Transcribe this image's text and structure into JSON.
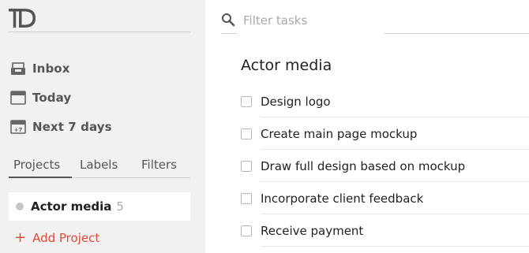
{
  "app": {
    "logo_text": "TD"
  },
  "sidebar": {
    "nav": [
      {
        "label": "Inbox",
        "icon": "inbox-icon"
      },
      {
        "label": "Today",
        "icon": "calendar-today-icon"
      },
      {
        "label": "Next 7 days",
        "icon": "calendar-week-icon",
        "icon_text": "+7"
      }
    ],
    "tabs": [
      {
        "label": "Projects",
        "active": true
      },
      {
        "label": "Labels",
        "active": false
      },
      {
        "label": "Filters",
        "active": false
      }
    ],
    "projects": [
      {
        "name": "Actor media",
        "count": "5",
        "color": "#c7c7c7"
      }
    ],
    "add_project_label": "Add Project",
    "add_project_color": "#dd4b39"
  },
  "main": {
    "search": {
      "placeholder": "Filter tasks",
      "value": ""
    },
    "project_title": "Actor media",
    "tasks": [
      {
        "label": "Design logo",
        "done": false
      },
      {
        "label": "Create main page mockup",
        "done": false
      },
      {
        "label": "Draw full design based on mockup",
        "done": false
      },
      {
        "label": "Incorporate client feedback",
        "done": false
      },
      {
        "label": "Receive payment",
        "done": false
      }
    ]
  }
}
